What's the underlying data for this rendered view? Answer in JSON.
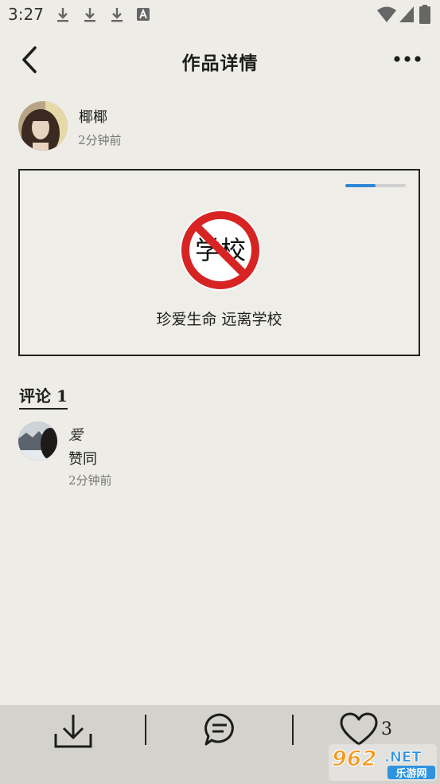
{
  "status_bar": {
    "time": "3:27"
  },
  "header": {
    "title": "作品详情"
  },
  "author": {
    "name": "椰椰",
    "time": "2分钟前"
  },
  "post": {
    "text": "珍爱生命 远离学校",
    "sign_text": "学校",
    "progress_percent": 50
  },
  "comments": {
    "heading": "评论 1",
    "items": [
      {
        "user": "爱",
        "text": "赞同",
        "time": "2分钟前"
      }
    ]
  },
  "bottom_bar": {
    "like_count": "3"
  },
  "watermark": {
    "number": "962",
    "suffix": ".NET",
    "caption": "乐游网"
  }
}
